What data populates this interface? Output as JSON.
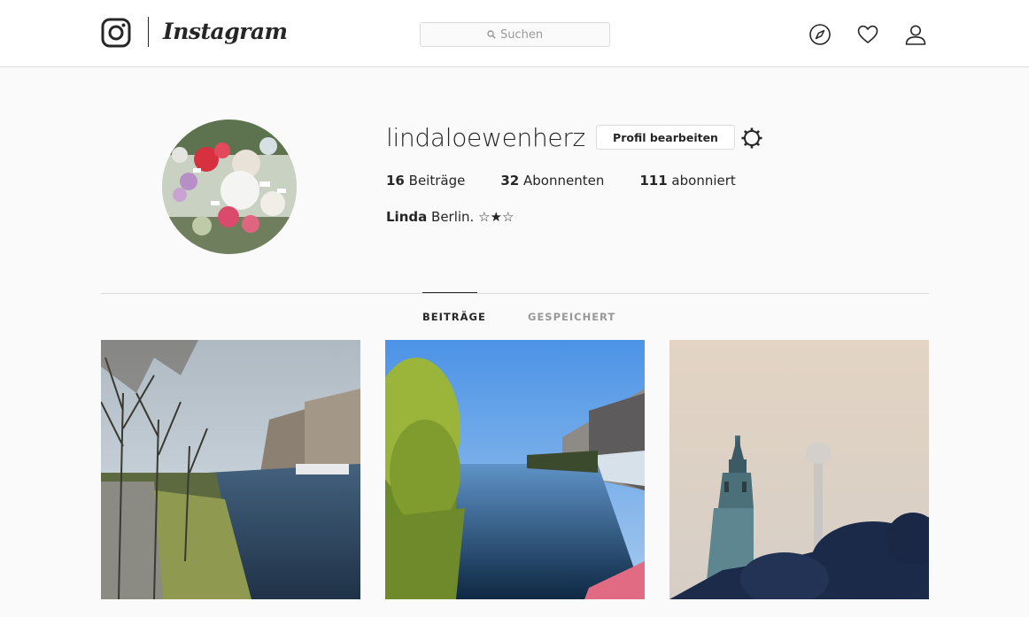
{
  "header": {
    "logo_icon": "instagram-camera-icon",
    "wordmark": "Instagram",
    "search": {
      "placeholder": "Suchen",
      "value": "",
      "icon": "search-icon"
    },
    "nav_icons": [
      "compass-explore-icon",
      "heart-activity-icon",
      "person-profile-icon"
    ]
  },
  "profile": {
    "username": "lindaloewenherz",
    "edit_button": "Profil bearbeiten",
    "settings_icon": "gear-icon",
    "stats": [
      {
        "count": "16",
        "label": "Beiträge"
      },
      {
        "count": "32",
        "label": "Abonnenten"
      },
      {
        "count": "111",
        "label": "abonniert"
      }
    ],
    "bio": {
      "name": "Linda",
      "text": "Berlin. ☆★☆"
    }
  },
  "tabs": [
    {
      "label": "BEITRÄGE",
      "active": true
    },
    {
      "label": "GESPEICHERT",
      "active": false
    }
  ],
  "posts": [
    {
      "subject": "canal-with-bare-trees"
    },
    {
      "subject": "canal-with-willow-tree"
    },
    {
      "subject": "church-and-tv-tower-in-fog"
    }
  ],
  "colors": {
    "background": "#fafafa",
    "text": "#262626",
    "border": "#dbdbdb",
    "muted": "#999999"
  }
}
